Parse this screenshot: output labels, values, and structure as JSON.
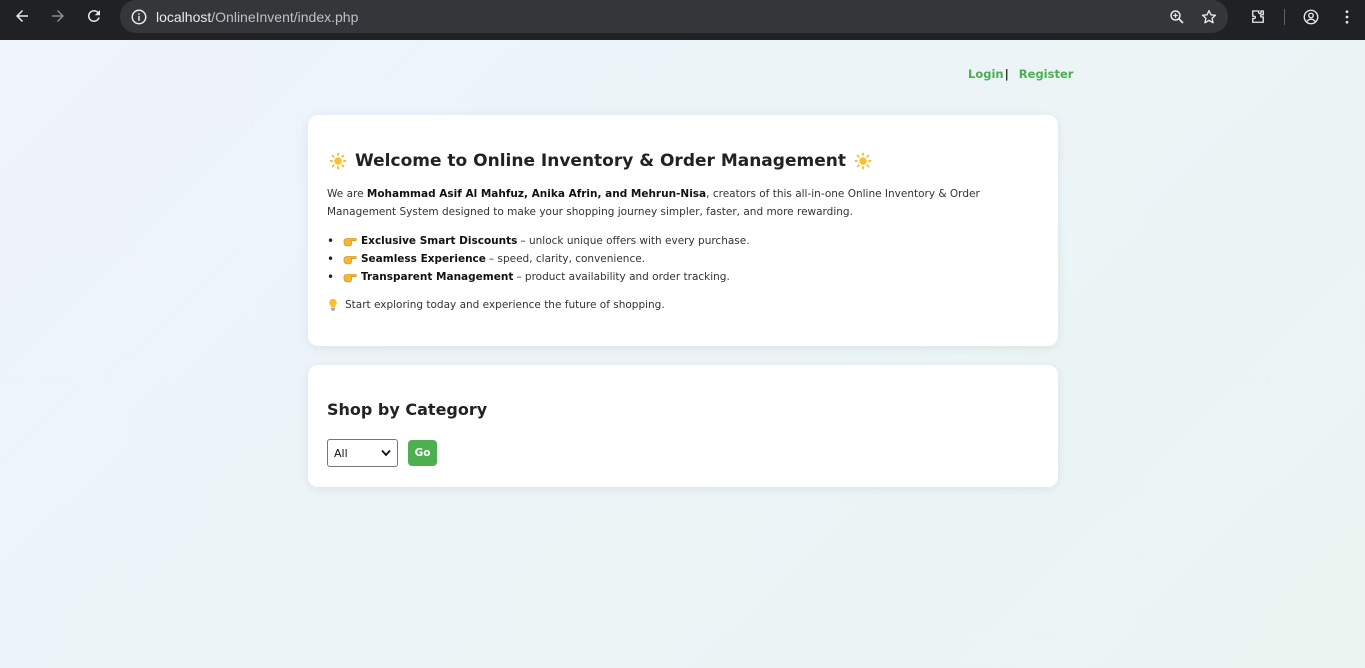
{
  "browser": {
    "url_host": "localhost",
    "url_path": "/OnlineInvent/index.php"
  },
  "nav": {
    "login": "Login",
    "separator": "|",
    "register": "Register"
  },
  "welcome": {
    "title": "Welcome to Online Inventory & Order Management",
    "intro_prefix": "We are ",
    "intro_names": "Mohammad Asif Al Mahfuz, Anika Afrin, and Mehrun-Nisa",
    "intro_suffix": ", creators of this all-in-one Online Inventory & Order Management System designed to make your shopping journey simpler, faster, and more rewarding.",
    "features": [
      {
        "title": "Exclusive Smart Discounts",
        "text": "– unlock unique offers with every purchase."
      },
      {
        "title": "Seamless Experience",
        "text": "– speed, clarity, convenience."
      },
      {
        "title": "Transparent Management",
        "text": "– product availability and order tracking."
      }
    ],
    "explore": "Start exploring today and experience the future of shopping."
  },
  "category": {
    "title": "Shop by Category",
    "selected": "All",
    "go_label": "Go"
  },
  "colors": {
    "accent": "#4caf50",
    "chrome_bg": "#202124"
  },
  "icons": [
    "back-arrow-icon",
    "forward-arrow-icon",
    "reload-icon",
    "site-info-icon",
    "zoom-icon",
    "bookmark-star-icon",
    "extensions-icon",
    "profile-icon",
    "menu-kebab-icon",
    "sun-icon",
    "pointing-hand-icon",
    "lightbulb-icon"
  ]
}
